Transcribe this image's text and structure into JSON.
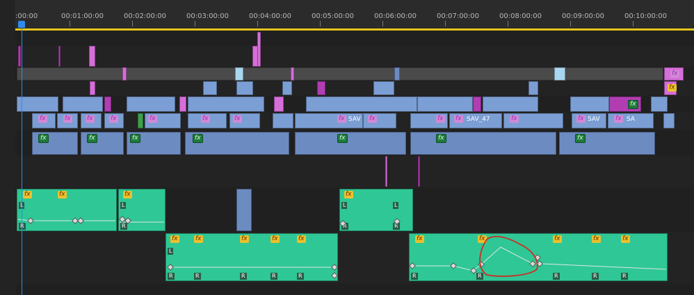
{
  "ruler": {
    "labels": [
      ":00:00",
      "00:01:00:00",
      "00:02:00:00",
      "00:03:00:00",
      "00:04:00:00",
      "00:05:00:00",
      "00:06:00:00",
      "00:07:00:00",
      "00:08:00:00",
      "00:09:00:00",
      "00:10:00:00"
    ]
  },
  "clips": {
    "fx": "fx",
    "sav": "SAV",
    "sav47": "SAV_47",
    "sa": "SA",
    "left": "L",
    "right": "R"
  },
  "colors": {
    "video_clip": "#7b9ed4",
    "audio_clip": "#2fc795",
    "adjustment_clip": "#d66ed9",
    "playhead": "#2d8ceb",
    "work_area_bar": "#e5c51b",
    "annotation": "#c0392b"
  },
  "icons": [
    "fx-badge-icon",
    "keyframe-icon",
    "playhead-icon"
  ]
}
